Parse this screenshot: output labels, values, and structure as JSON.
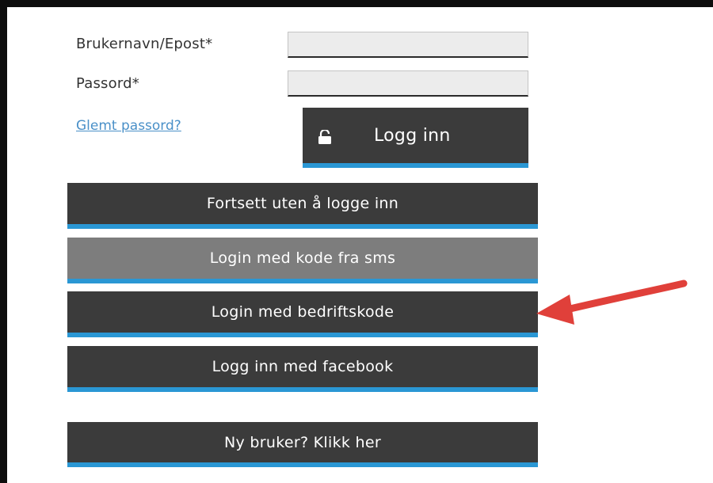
{
  "form": {
    "username_label": "Brukernavn/Epost*",
    "username_value": "",
    "password_label": "Passord*",
    "password_value": "",
    "forgot_password_link": "Glemt passord?",
    "login_button": "Logg inn"
  },
  "buttons": {
    "continue_without_login": "Fortsett uten å logge inn",
    "login_sms_code": "Login med kode fra sms",
    "login_company_code": "Login med bedriftskode",
    "login_facebook": "Logg inn med facebook",
    "new_user": "Ny bruker? Klikk her"
  },
  "icons": {
    "login_icon": "unlock-icon",
    "annotation": "red-arrow-icon"
  },
  "colors": {
    "button_bg": "#3b3b3b",
    "button_selected_bg": "#7d7d7d",
    "button_accent": "#2a97d4",
    "link": "#4a90c8",
    "arrow": "#e0403a"
  }
}
